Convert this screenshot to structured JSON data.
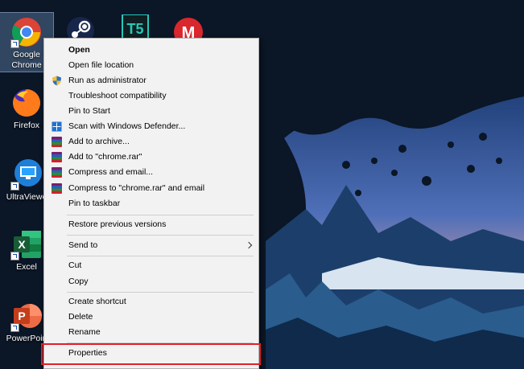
{
  "desktop": {
    "icons": [
      {
        "label": "Google Chrome",
        "icon": "chrome-icon"
      },
      {
        "label": "Firefox",
        "icon": "firefox-icon"
      },
      {
        "label": "UltraViewer",
        "icon": "ultraviewer-icon"
      },
      {
        "label": "Excel",
        "icon": "excel-icon"
      },
      {
        "label": "PowerPoint",
        "icon": "powerpoint-icon"
      }
    ],
    "top_row_icons": [
      "steam-icon",
      "app-tf-icon",
      "mega-icon"
    ],
    "chrome_label_line1": "Google",
    "chrome_label_line2": "Chrome",
    "firefox_label": "Firefox",
    "ultraviewer_label": "UltraViewe",
    "excel_label": "Excel",
    "powerpoint_label": "PowerPoin",
    "excel_glyph": "X",
    "powerpoint_glyph": "P",
    "mega_glyph": "M",
    "tf_glyph": "T5"
  },
  "context_menu": {
    "items": [
      {
        "label": "Open",
        "bold": true
      },
      {
        "label": "Open file location"
      },
      {
        "label": "Run as administrator",
        "icon": "uac-shield-icon"
      },
      {
        "label": "Troubleshoot compatibility"
      },
      {
        "label": "Pin to Start"
      },
      {
        "label": "Scan with Windows Defender...",
        "icon": "windows-defender-icon"
      },
      {
        "label": "Add to archive...",
        "icon": "winrar-icon"
      },
      {
        "label": "Add to \"chrome.rar\"",
        "icon": "winrar-icon"
      },
      {
        "label": "Compress and email...",
        "icon": "winrar-icon"
      },
      {
        "label": "Compress to \"chrome.rar\" and email",
        "icon": "winrar-icon"
      },
      {
        "label": "Pin to taskbar"
      },
      {
        "label": "Restore previous versions"
      },
      {
        "label": "Send to",
        "submenu": true
      },
      {
        "label": "Cut"
      },
      {
        "label": "Copy"
      },
      {
        "label": "Create shortcut"
      },
      {
        "label": "Delete"
      },
      {
        "label": "Rename"
      },
      {
        "label": "Properties",
        "highlighted": true
      }
    ]
  },
  "colors": {
    "menu_bg": "#f2f2f2",
    "highlight_border": "#e0202a",
    "wallpaper_sky_top": "#0b1626",
    "wallpaper_sky_glow": "#e8a98a"
  }
}
